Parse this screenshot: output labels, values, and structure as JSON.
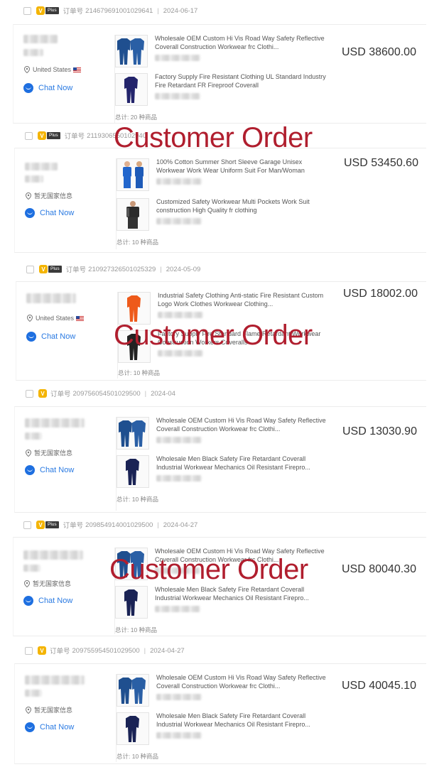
{
  "watermark": "Customer Order",
  "labels": {
    "order_no": "订单号",
    "plus": "Plus",
    "chat": "Chat Now"
  },
  "orders": [
    {
      "order_no": "214679691001029641",
      "date": "2024-06-17",
      "country": "United States",
      "price": "USD 38600.00",
      "total": "总计: 20 种商品",
      "items": [
        {
          "title": "Wholesale OEM Custom Hi Vis Road Way Safety Reflective Coverall Construction Workwear frc Clothi..."
        },
        {
          "title": "Factory Supply Fire Resistant Clothing UL Standard Industry Fire Retardant FR Fireproof Coverall"
        }
      ]
    },
    {
      "order_no": "21193065‌501029‌40",
      "date": "",
      "country": "暂无国家信息",
      "price": "USD 53450.60",
      "total": "总计: 10 种商品",
      "items": [
        {
          "title": "100% Cotton Summer Short Sleeve Garage Unisex Workwear Work Wear Uniform Suit For Man/Woman"
        },
        {
          "title": "Customized Safety Workwear Multi Pockets Work Suit construction High Quality fr clothing"
        }
      ]
    },
    {
      "order_no": "210927326501025329",
      "date": "2024-05-09",
      "country": "United States",
      "price": "USD 18002.00",
      "total": "总计: 10 种商品",
      "items": [
        {
          "title": "Industrial Safety Clothing Anti-static Fire Resistant Custom Logo Work Clothes Workwear Clothing..."
        },
        {
          "title": "Factory Supply Fire Standard Flame Retardant Workwear Construction Workers Coveralls"
        }
      ]
    },
    {
      "order_no": "209756054501029500",
      "date": "2024-04",
      "country": "暂无国家信息",
      "price": "USD 13030.90",
      "total": "总计: 10 种商品",
      "items": [
        {
          "title": "Wholesale OEM Custom Hi Vis Road Way Safety Reflective Coverall Construction Workwear frc Clothi..."
        },
        {
          "title": "Wholesale Men Black Safety Fire Retardant Coverall Industrial Workwear Mechanics Oil Resistant Firepro..."
        }
      ]
    },
    {
      "order_no": "209854914001029500",
      "date": "2024-04-27",
      "country": "暂无国家信息",
      "price": "USD 80040.30",
      "total": "总计: 10 种商品",
      "items": [
        {
          "title": "Wholesale OEM Custom Hi Vis Road Way Safety Reflective Coverall Construction Workwear frc Clothi..."
        },
        {
          "title": "Wholesale Men Black Safety Fire Retardant Coverall Industrial Workwear Mechanics Oil Resistant Firepro..."
        }
      ]
    },
    {
      "order_no": "209755954501029500",
      "date": "2024-04-27",
      "country": "暂无国家信息",
      "price": "USD 40045.10",
      "total": "总计: 10 种商品",
      "items": [
        {
          "title": "Wholesale OEM Custom Hi Vis Road Way Safety Reflective Coverall Construction Workwear frc Clothi..."
        },
        {
          "title": "Wholesale Men Black Safety Fire Retardant Coverall Industrial Workwear Mechanics Oil Resistant Firepro..."
        }
      ]
    }
  ]
}
